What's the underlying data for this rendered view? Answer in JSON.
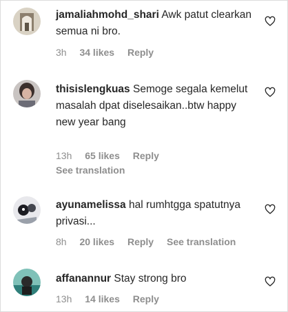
{
  "comments": [
    {
      "username": "jamaliahmohd_shari",
      "text": "Awk patut clearkan semua ni bro.",
      "time": "3h",
      "likes": "34 likes",
      "reply": "Reply",
      "see_translation": ""
    },
    {
      "username": "thisislengkuas",
      "text": "Semoge segala kemelut masalah dpat diselesaikan..btw happy new year bang",
      "time": "13h",
      "likes": "65 likes",
      "reply": "Reply",
      "see_translation": "See translation"
    },
    {
      "username": "ayunamelissa",
      "text": "hal rumhtgga spatutnya privasi...",
      "time": "8h",
      "likes": "20 likes",
      "reply": "Reply",
      "see_translation": "See translation"
    },
    {
      "username": "affanannur",
      "text": "Stay strong bro",
      "time": "13h",
      "likes": "14 likes",
      "reply": "Reply",
      "see_translation": ""
    }
  ],
  "icons": {
    "like": "heart-outline-icon"
  }
}
